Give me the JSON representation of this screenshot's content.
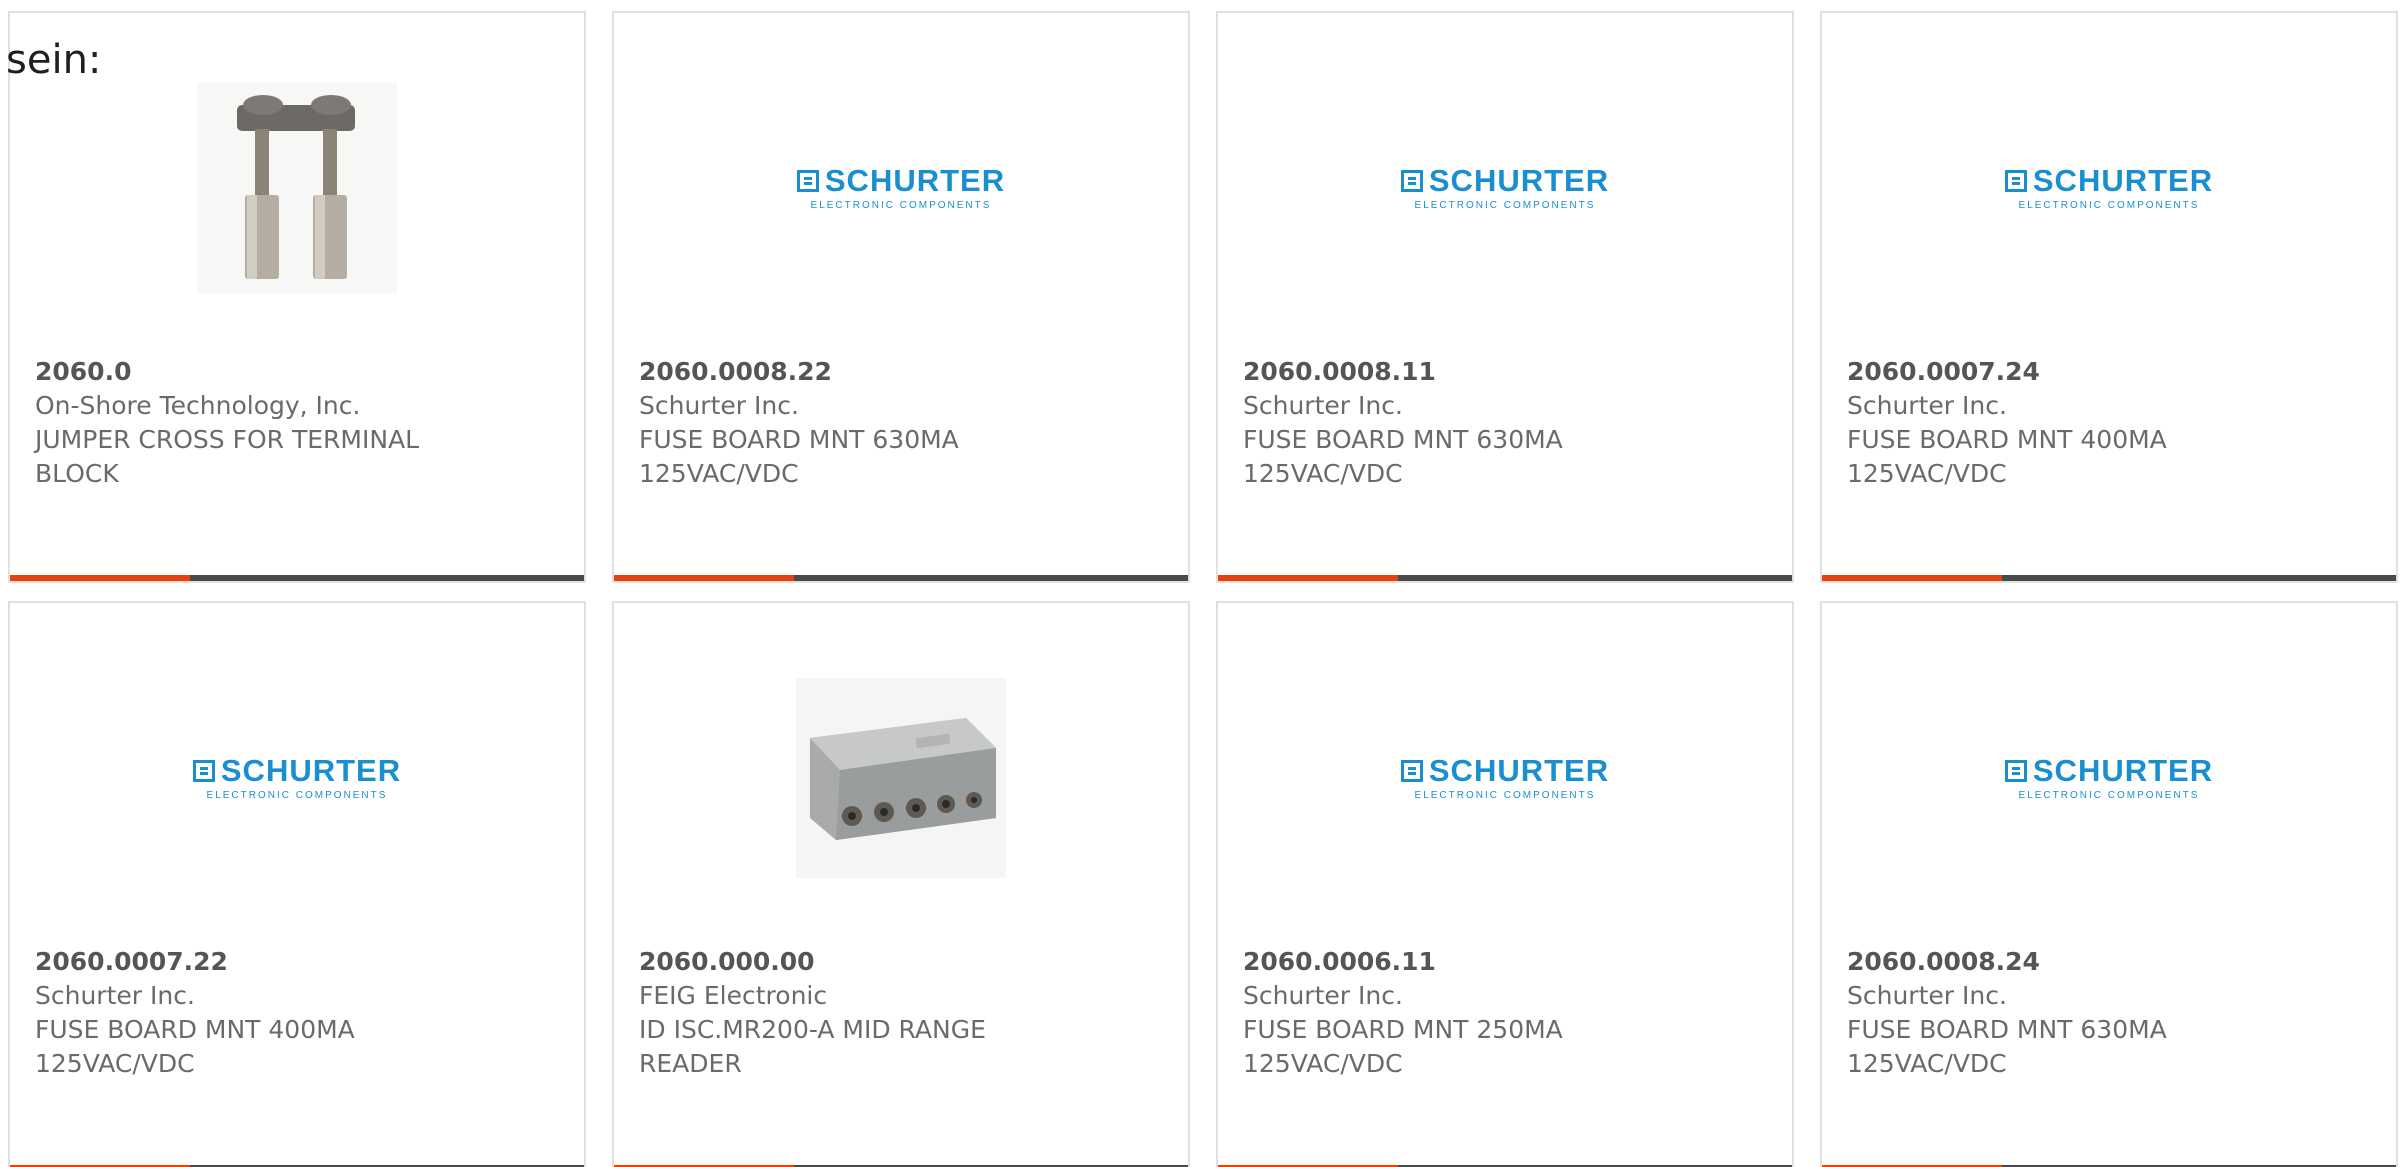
{
  "intro_text": "sein:",
  "colors": {
    "accent": "#e8410f",
    "bar": "#444a4e",
    "logo_blue": "#1a8fd0"
  },
  "logo": {
    "name": "SCHURTER",
    "tagline": "ELECTRONIC COMPONENTS"
  },
  "products": [
    {
      "part": "2060.0",
      "manufacturer": "On-Shore Technology, Inc.",
      "description": "JUMPER CROSS FOR TERMINAL BLOCK",
      "image": "jumper-photo"
    },
    {
      "part": "2060.0008.22",
      "manufacturer": "Schurter Inc.",
      "description": "FUSE BOARD MNT 630MA 125VAC/VDC",
      "image": "schurter-logo"
    },
    {
      "part": "2060.0008.11",
      "manufacturer": "Schurter Inc.",
      "description": "FUSE BOARD MNT 630MA 125VAC/VDC",
      "image": "schurter-logo"
    },
    {
      "part": "2060.0007.24",
      "manufacturer": "Schurter Inc.",
      "description": "FUSE BOARD MNT 400MA 125VAC/VDC",
      "image": "schurter-logo"
    },
    {
      "part": "2060.0007.22",
      "manufacturer": "Schurter Inc.",
      "description": "FUSE BOARD MNT 400MA 125VAC/VDC",
      "image": "schurter-logo"
    },
    {
      "part": "2060.000.00",
      "manufacturer": "FEIG Electronic",
      "description": "ID ISC.MR200-A MID RANGE READER",
      "image": "reader-photo"
    },
    {
      "part": "2060.0006.11",
      "manufacturer": "Schurter Inc.",
      "description": "FUSE BOARD MNT 250MA 125VAC/VDC",
      "image": "schurter-logo"
    },
    {
      "part": "2060.0008.24",
      "manufacturer": "Schurter Inc.",
      "description": "FUSE BOARD MNT 630MA 125VAC/VDC",
      "image": "schurter-logo"
    }
  ]
}
